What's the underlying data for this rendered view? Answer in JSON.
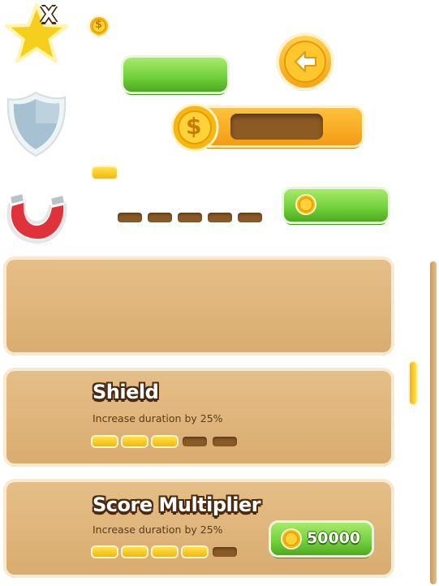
{
  "icons": {
    "star": "star-x-icon",
    "shield": "shield-icon",
    "magnet": "magnet-icon",
    "coin": "coin-icon",
    "back": "back-arrow-icon"
  },
  "top_widgets": {
    "star_badge": "X",
    "coin_symbol": "$",
    "progress_empty_pips": 5
  },
  "upgrades": [
    {
      "title": "",
      "description": "",
      "level": 0,
      "max_level": 0
    },
    {
      "title": "Shield",
      "description": "Increase duration by 25%",
      "level": 3,
      "max_level": 5
    },
    {
      "title": "Score Multiplier",
      "description": "Increase duration by 25%",
      "level": 4,
      "max_level": 5,
      "price": "50000"
    }
  ],
  "colors": {
    "green_button": "#6fcf3a",
    "orange_bar": "#f39b15",
    "panel": "#dfb57c",
    "pip_filled": "#f5c21a",
    "pip_empty": "#8a5a26",
    "title_outline": "#4a2a10"
  }
}
